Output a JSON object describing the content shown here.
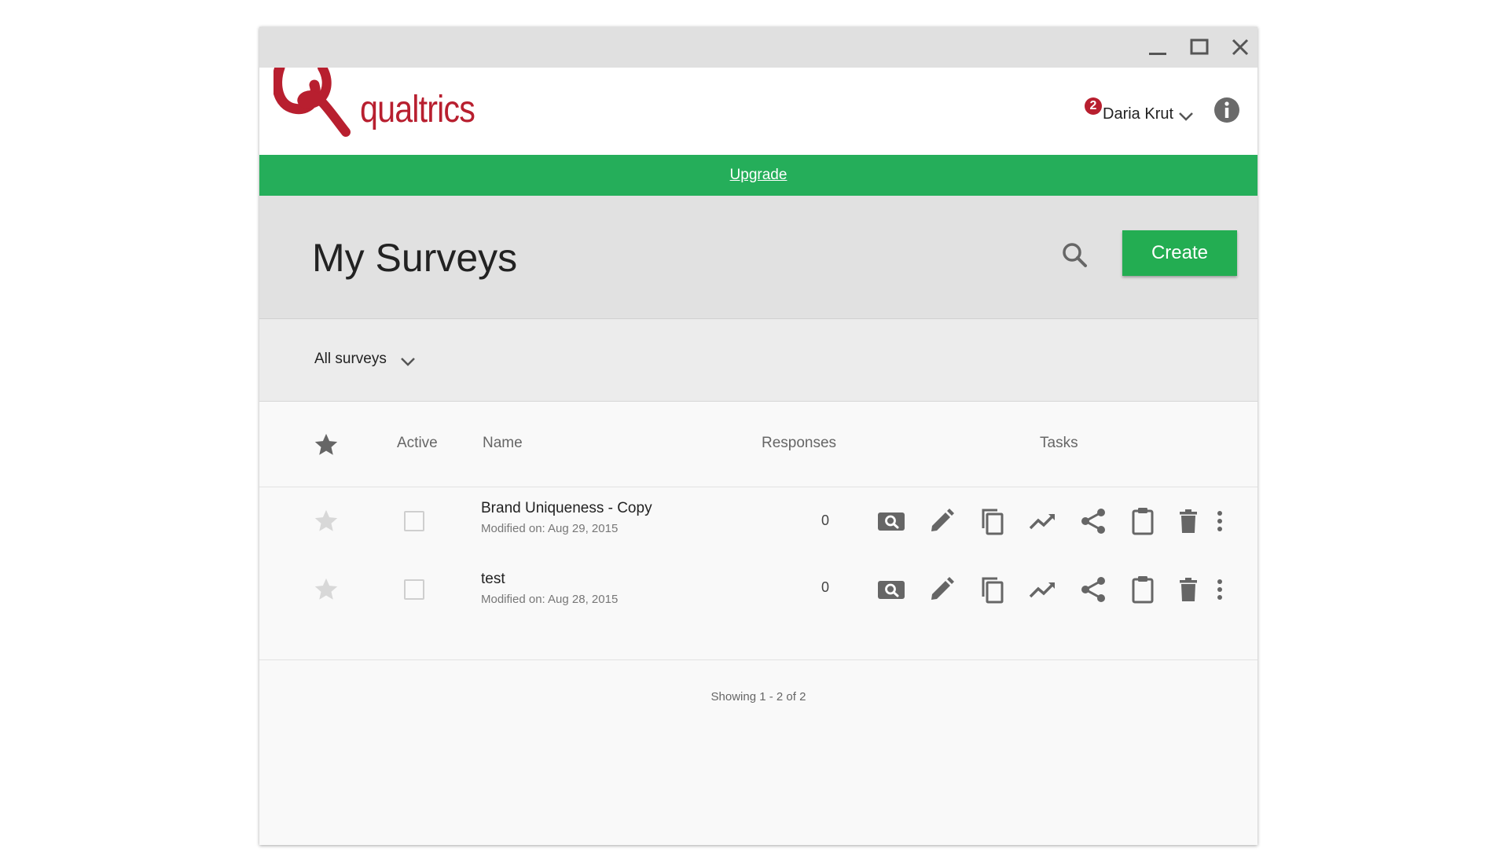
{
  "app": {
    "brand": "qualtrics",
    "brand_color": "#b81f2f",
    "accent_green": "#25ae5a"
  },
  "window_controls": [
    "minimize-icon",
    "maximize-icon",
    "close-icon"
  ],
  "header": {
    "notification_count": "2",
    "user_name": "Daria Krut",
    "info_icon": "info-icon"
  },
  "upgrade": {
    "label": "Upgrade"
  },
  "title_section": {
    "title": "My Surveys",
    "create_label": "Create"
  },
  "filter": {
    "label": "All surveys"
  },
  "table": {
    "headers": {
      "active": "Active",
      "name": "Name",
      "responses": "Responses",
      "tasks": "Tasks"
    },
    "rows": [
      {
        "name": "Brand Uniqueness - Copy",
        "modified": "Modified on: Aug 29, 2015",
        "responses": "0",
        "starred": false,
        "active": false
      },
      {
        "name": "test",
        "modified": "Modified on: Aug 28, 2015",
        "responses": "0",
        "starred": false,
        "active": false
      }
    ],
    "task_icons": [
      "preview-icon",
      "edit-icon",
      "copy-icon",
      "reports-icon",
      "share-icon",
      "clipboard-icon",
      "delete-icon",
      "more-icon"
    ]
  },
  "footer": {
    "showing": "Showing 1 - 2 of 2"
  }
}
